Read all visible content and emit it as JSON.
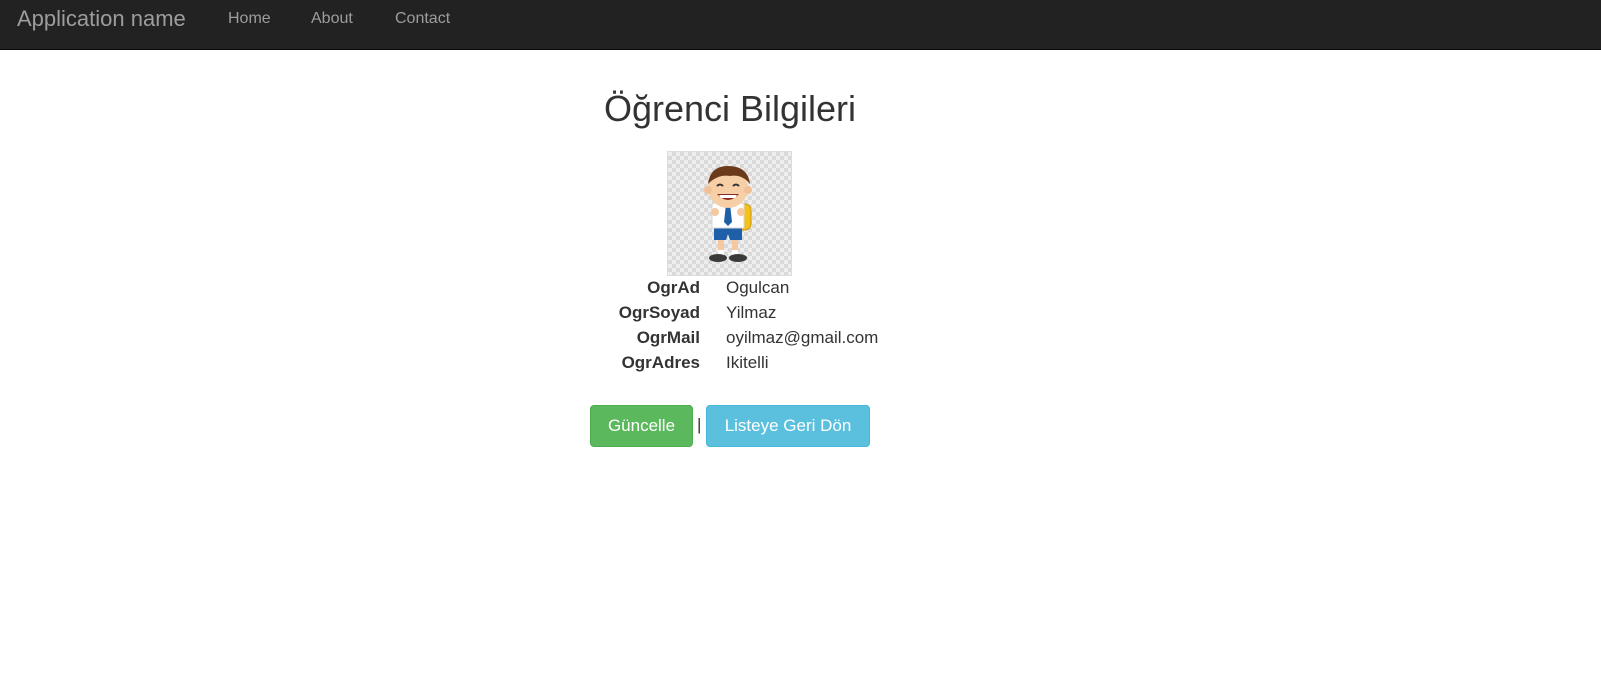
{
  "navbar": {
    "brand": "Application name",
    "links": [
      "Home",
      "About",
      "Contact"
    ]
  },
  "page": {
    "title": "Öğrenci Bilgileri"
  },
  "student": {
    "photo_icon": "student-cartoon-image",
    "fields": [
      {
        "label": "OgrAd",
        "value": "Ogulcan"
      },
      {
        "label": "OgrSoyad",
        "value": "Yilmaz"
      },
      {
        "label": "OgrMail",
        "value": "oyilmaz@gmail.com"
      },
      {
        "label": "OgrAdres",
        "value": "Ikitelli"
      }
    ]
  },
  "actions": {
    "update_label": "Güncelle",
    "separator": "|",
    "back_label": "Listeye Geri Dön"
  },
  "colors": {
    "navbar_bg": "#222222",
    "nav_text": "#9d9d9d",
    "success": "#5cb85c",
    "info": "#5bc0de"
  }
}
